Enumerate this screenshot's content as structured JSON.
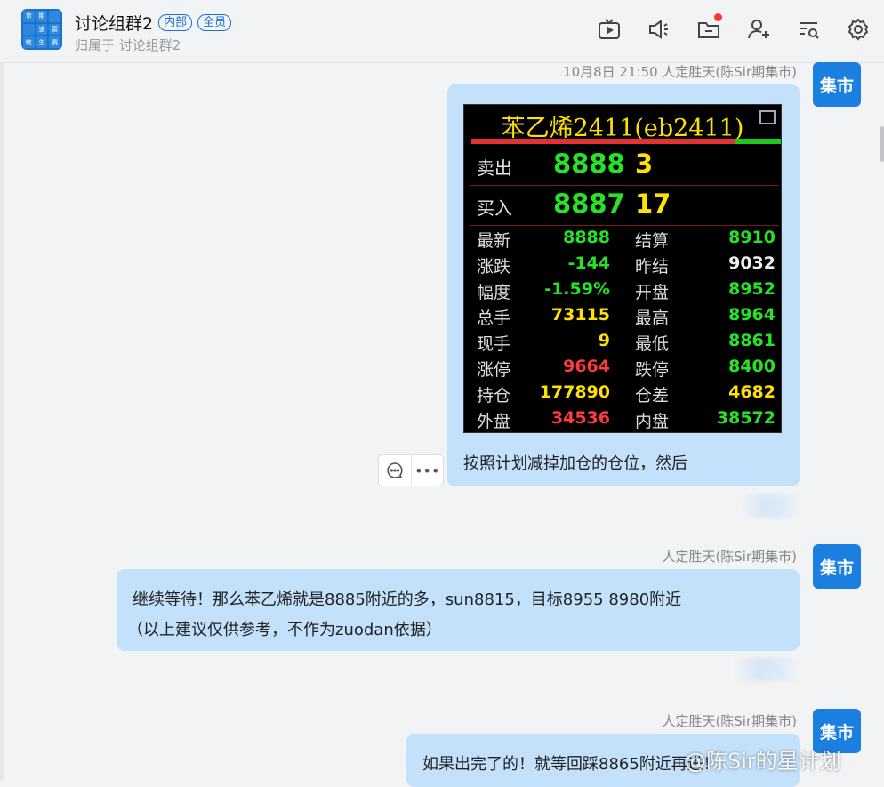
{
  "header": {
    "avatar_cells": [
      "市",
      "期",
      "",
      "",
      "速",
      "富",
      "敏",
      "生",
      "赛"
    ],
    "title": "讨论组群2",
    "tag_internal": "内部",
    "tag_all": "全员",
    "subtitle": "归属于 讨论组群2"
  },
  "toolbar": {
    "icons": [
      "tv-icon",
      "volume-icon",
      "folder-icon",
      "add-user-icon",
      "search-list-icon",
      "settings-icon"
    ]
  },
  "messages": [
    {
      "meta": "10月8日 21:50  人定胜天(陈Sir期集市)",
      "avatar": "集市",
      "caption": "按照计划减掉加仓的仓位，然后"
    },
    {
      "meta": "人定胜天(陈Sir期集市)",
      "avatar": "集市",
      "line1": "继续等待！那么苯乙烯就是8885附近的多，sun8815，目标8955 8980附近",
      "line2": "（以上建议仅供参考，不作为zuodan依据）"
    },
    {
      "meta": "人定胜天(陈Sir期集市)",
      "avatar": "集市",
      "line1": "如果出完了的！就等回踩8865附近再进！"
    }
  ],
  "quote": {
    "title": "苯乙烯2411(eb2411)",
    "sell_label": "卖出",
    "sell_price": "8888",
    "sell_vol": "3",
    "buy_label": "买入",
    "buy_price": "8887",
    "buy_vol": "17",
    "rows": [
      {
        "l1": "最新",
        "v1": "8888",
        "c1": "#27e327",
        "l2": "结算",
        "v2": "8910",
        "c2": "#27e327"
      },
      {
        "l1": "涨跌",
        "v1": "-144",
        "c1": "#27e327",
        "l2": "昨结",
        "v2": "9032",
        "c2": "#eeeeee"
      },
      {
        "l1": "幅度",
        "v1": "-1.59%",
        "c1": "#27e327",
        "l2": "开盘",
        "v2": "8952",
        "c2": "#27e327"
      },
      {
        "l1": "总手",
        "v1": "73115",
        "c1": "#ffe100",
        "l2": "最高",
        "v2": "8964",
        "c2": "#27e327"
      },
      {
        "l1": "现手",
        "v1": "9",
        "c1": "#ffe100",
        "l2": "最低",
        "v2": "8861",
        "c2": "#27e327"
      },
      {
        "l1": "涨停",
        "v1": "9664",
        "c1": "#ff3b3b",
        "l2": "跌停",
        "v2": "8400",
        "c2": "#27e327"
      },
      {
        "l1": "持仓",
        "v1": "177890",
        "c1": "#ffe100",
        "l2": "仓差",
        "v2": "4682",
        "c2": "#ffe100"
      },
      {
        "l1": "外盘",
        "v1": "34536",
        "c1": "#ff3b3b",
        "l2": "内盘",
        "v2": "38572",
        "c2": "#27e327"
      }
    ]
  },
  "actions": {
    "comment_icon": "comment-icon",
    "more_label": "•••"
  },
  "watermark": "@陈Sir的星计划",
  "colors": {
    "accent": "#1b7fe0",
    "bubble": "#c4e1fb"
  }
}
